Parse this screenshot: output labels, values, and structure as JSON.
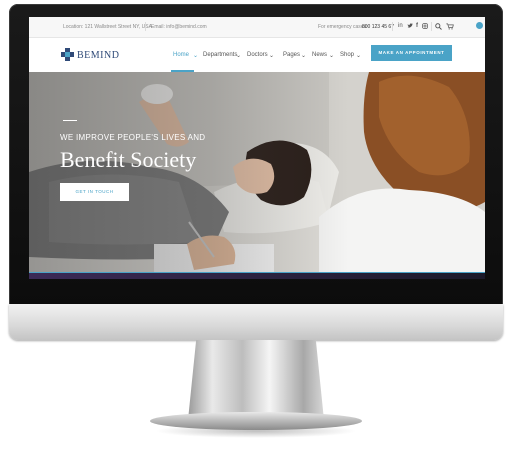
{
  "topbar": {
    "location": "Location: 121 Wallstreet Street NY, USA",
    "email": "Email: info@bemind.com",
    "emergency": "For emergency cases:",
    "phone": "800 123 45 67",
    "social_icons": [
      "linkedin-icon",
      "twitter-icon",
      "facebook-icon",
      "instagram-icon"
    ],
    "search_icon": "search-icon",
    "cart_icon": "cart-icon"
  },
  "brand": {
    "name": "BEMIND",
    "color_primary": "#2f4a78",
    "color_accent": "#4aa3c7"
  },
  "nav": {
    "items": [
      {
        "label": "Home"
      },
      {
        "label": "Departments"
      },
      {
        "label": "Doctors"
      },
      {
        "label": "Pages"
      },
      {
        "label": "News"
      },
      {
        "label": "Shop"
      }
    ],
    "active": "Home",
    "cta_label": "MAKE AN APPOINTMENT"
  },
  "hero": {
    "kicker": "WE IMPROVE PEOPLE'S LIVES AND",
    "title": "Benefit Society",
    "button_label": "GET IN TOUCH"
  }
}
